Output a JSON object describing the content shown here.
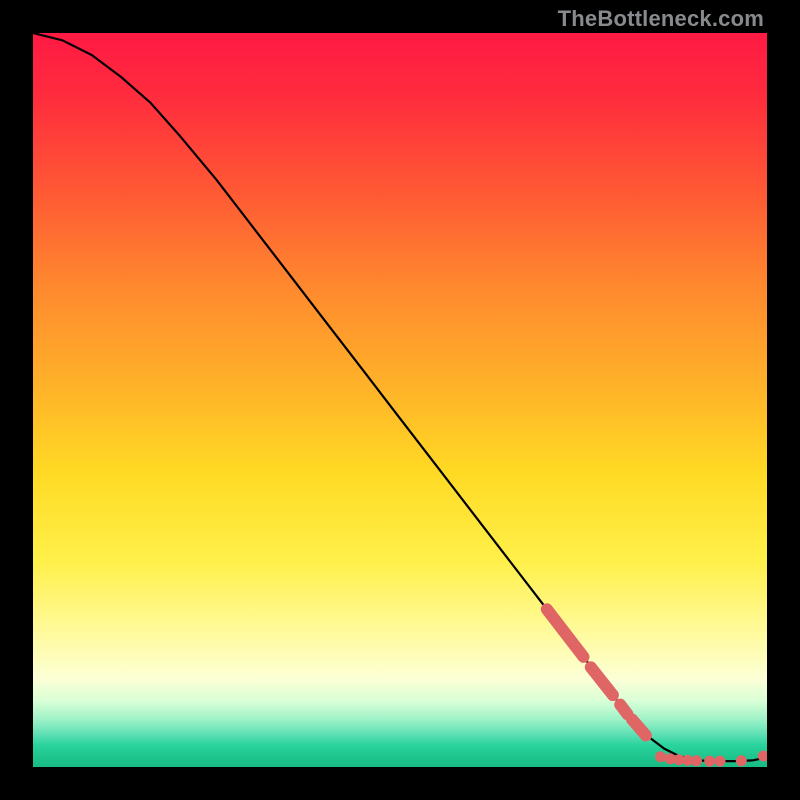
{
  "watermark": "TheBottleneck.com",
  "colors": {
    "dot": "#e06666",
    "curve": "#000000",
    "gradient_top": "#ff1a44",
    "gradient_bottom": "#18bc83"
  },
  "chart_data": {
    "type": "line",
    "title": "",
    "xlabel": "",
    "ylabel": "",
    "xlim": [
      0,
      100
    ],
    "ylim": [
      0,
      100
    ],
    "curve": {
      "name": "bottleneck-curve",
      "x": [
        0,
        4,
        8,
        12,
        16,
        20,
        25,
        30,
        35,
        40,
        45,
        50,
        55,
        60,
        65,
        70,
        75,
        80,
        82,
        84,
        86,
        88,
        90,
        92,
        94,
        96,
        98,
        100
      ],
      "y": [
        100,
        99,
        97,
        94,
        90.5,
        86,
        80,
        73.5,
        67,
        60.5,
        54,
        47.5,
        41,
        34.5,
        28,
        21.5,
        15,
        8.5,
        6,
        4,
        2.5,
        1.5,
        1,
        0.8,
        0.8,
        0.8,
        0.9,
        1.3
      ]
    },
    "highlight_segments": [
      {
        "x0": 70,
        "y0": 21.5,
        "x1": 75,
        "y1": 15.0
      },
      {
        "x0": 76,
        "y0": 13.6,
        "x1": 79,
        "y1": 9.8
      },
      {
        "x0": 80,
        "y0": 8.5,
        "x1": 81,
        "y1": 7.2
      },
      {
        "x0": 81.6,
        "y0": 6.5,
        "x1": 83.5,
        "y1": 4.3
      }
    ],
    "highlight_points": [
      {
        "x": 85.5,
        "y": 1.4
      },
      {
        "x": 86.8,
        "y": 1.1
      },
      {
        "x": 88.0,
        "y": 1.0
      },
      {
        "x": 89.2,
        "y": 0.9
      },
      {
        "x": 90.4,
        "y": 0.85
      },
      {
        "x": 92.2,
        "y": 0.8
      },
      {
        "x": 93.6,
        "y": 0.8
      },
      {
        "x": 96.5,
        "y": 0.85
      },
      {
        "x": 99.5,
        "y": 1.5
      }
    ]
  }
}
